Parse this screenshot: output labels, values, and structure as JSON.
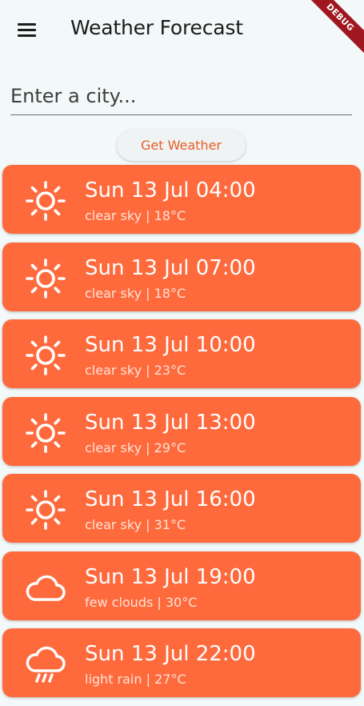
{
  "appbar": {
    "title": "Weather Forecast",
    "debug_label": "DEBUG"
  },
  "search": {
    "placeholder": "Enter a city...",
    "value": ""
  },
  "button": {
    "label": "Get Weather"
  },
  "colors": {
    "card": "#ff6a3d",
    "accent": "#e85d26",
    "background": "#f3f9f9"
  },
  "forecast": [
    {
      "time": "Sun 13 Jul 04:00",
      "summary": "clear sky | 18°C",
      "icon": "sun-icon"
    },
    {
      "time": "Sun 13 Jul 07:00",
      "summary": "clear sky | 18°C",
      "icon": "sun-icon"
    },
    {
      "time": "Sun 13 Jul 10:00",
      "summary": "clear sky | 23°C",
      "icon": "sun-icon"
    },
    {
      "time": "Sun 13 Jul 13:00",
      "summary": "clear sky | 29°C",
      "icon": "sun-icon"
    },
    {
      "time": "Sun 13 Jul 16:00",
      "summary": "clear sky | 31°C",
      "icon": "sun-icon"
    },
    {
      "time": "Sun 13 Jul 19:00",
      "summary": "few clouds | 30°C",
      "icon": "cloud-icon"
    },
    {
      "time": "Sun 13 Jul 22:00",
      "summary": "light rain | 27°C",
      "icon": "rain-icon"
    }
  ]
}
